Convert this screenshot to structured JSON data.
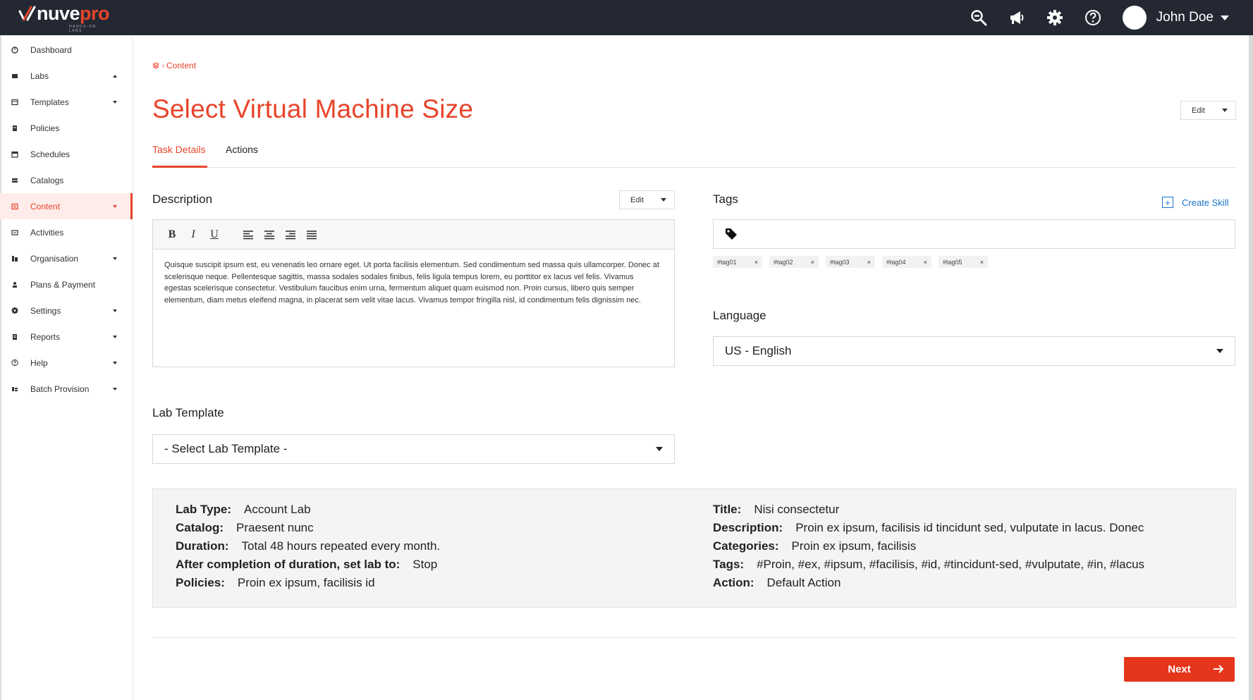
{
  "brand": {
    "name_part1": "nuve",
    "name_part2": "pro",
    "tagline": "HANDS-ON LABS",
    "accent": "#e8442b",
    "topbar_bg": "#232833"
  },
  "topbar": {
    "icons": [
      "zoom-out-icon",
      "megaphone-icon",
      "gear-icon",
      "help-icon"
    ],
    "user_name": "John Doe"
  },
  "sidebar": {
    "items": [
      {
        "label": "Dashboard",
        "icon": "dashboard-icon",
        "caret": "none"
      },
      {
        "label": "Labs",
        "icon": "labs-icon",
        "caret": "up"
      },
      {
        "label": "Templates",
        "icon": "templates-icon",
        "caret": "down"
      },
      {
        "label": "Policies",
        "icon": "policies-icon",
        "caret": "none"
      },
      {
        "label": "Schedules",
        "icon": "schedules-icon",
        "caret": "none"
      },
      {
        "label": "Catalogs",
        "icon": "catalogs-icon",
        "caret": "none"
      },
      {
        "label": "Content",
        "icon": "content-icon",
        "caret": "down",
        "active": true
      },
      {
        "label": "Activities",
        "icon": "activities-icon",
        "caret": "none"
      },
      {
        "label": "Organisation",
        "icon": "organisation-icon",
        "caret": "down"
      },
      {
        "label": "Plans & Payment",
        "icon": "plans-icon",
        "caret": "none"
      },
      {
        "label": "Settings",
        "icon": "settings-icon",
        "caret": "down"
      },
      {
        "label": "Reports",
        "icon": "reports-icon",
        "caret": "down"
      },
      {
        "label": "Help",
        "icon": "help-icon",
        "caret": "down"
      },
      {
        "label": "Batch Provision",
        "icon": "batch-icon",
        "caret": "down"
      }
    ]
  },
  "breadcrumb": {
    "label": "Content"
  },
  "page": {
    "title": "Select Virtual Machine Size",
    "edit_label": "Edit",
    "tabs": [
      {
        "label": "Task Details",
        "active": true
      },
      {
        "label": "Actions",
        "active": false
      }
    ]
  },
  "description": {
    "label": "Description",
    "edit_label": "Edit",
    "toolbar": {
      "bold": "B",
      "italic": "I",
      "underline": "U"
    },
    "text": "Quisque suscipit ipsum est, eu venenatis leo ornare eget. Ut porta facilisis elementum. Sed condimentum sed massa quis ullamcorper. Donec at scelerisque neque. Pellentesque sagittis, massa sodales sodales finibus, felis ligula tempus lorem, eu porttitor ex lacus vel felis. Vivamus egestas scelerisque consectetur. Vestibulum faucibus enim urna, fermentum aliquet quam euismod non. Proin cursus, libero quis semper elementum, diam metus eleifend magna, in placerat sem velit vitae lacus. Vivamus tempor fringilla nisl, id condimentum felis dignissim nec."
  },
  "tags": {
    "label": "Tags",
    "create_label": "Create Skill",
    "chips": [
      "#tag01",
      "#tag02",
      "#tag03",
      "#tag04",
      "#tag05"
    ],
    "remove_glyph": "×"
  },
  "language": {
    "label": "Language",
    "value": "US - English"
  },
  "lab_template": {
    "label": "Lab Template",
    "placeholder": "- Select Lab Template -"
  },
  "info": {
    "left": [
      {
        "key": "Lab Type:",
        "value": "Account Lab"
      },
      {
        "key": "Catalog:",
        "value": "Praesent nunc"
      },
      {
        "key": "Duration:",
        "value": "Total 48 hours repeated every month."
      },
      {
        "key": "After completion of duration, set lab to:",
        "value": "Stop"
      },
      {
        "key": "Policies:",
        "value": "Proin ex ipsum, facilisis id"
      }
    ],
    "right": [
      {
        "key": "Title:",
        "value": "Nisi consectetur"
      },
      {
        "key": "Description:",
        "value": "Proin ex ipsum, facilisis id tincidunt sed, vulputate in lacus. Donec"
      },
      {
        "key": "Categories:",
        "value": "Proin ex ipsum, facilisis"
      },
      {
        "key": "Tags:",
        "value": "#Proin, #ex, #ipsum, #facilisis, #id, #tincidunt-sed, #vulputate, #in, #lacus"
      },
      {
        "key": "Action:",
        "value": "Default Action"
      }
    ]
  },
  "footer": {
    "next_label": "Next"
  }
}
